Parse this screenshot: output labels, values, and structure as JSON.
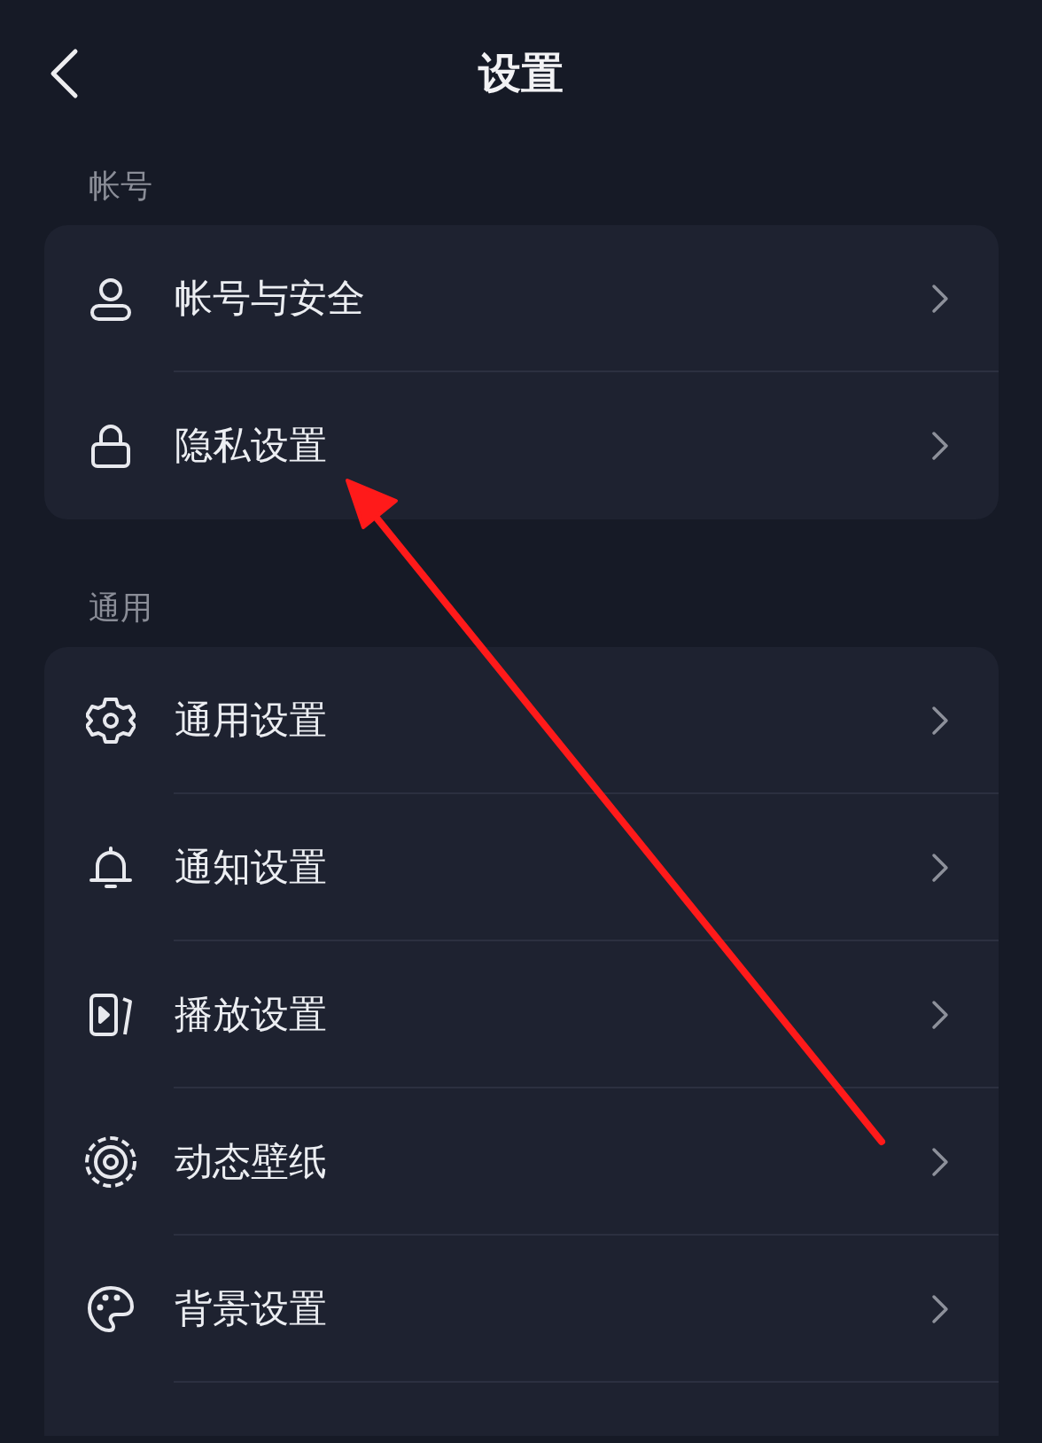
{
  "header": {
    "title": "设置"
  },
  "sections": [
    {
      "title": "帐号",
      "items": [
        {
          "label": "帐号与安全"
        },
        {
          "label": "隐私设置"
        }
      ]
    },
    {
      "title": "通用",
      "items": [
        {
          "label": "通用设置"
        },
        {
          "label": "通知设置"
        },
        {
          "label": "播放设置"
        },
        {
          "label": "动态壁纸"
        },
        {
          "label": "背景设置"
        }
      ]
    }
  ],
  "annotations": [
    {
      "kind": "arrow"
    }
  ]
}
